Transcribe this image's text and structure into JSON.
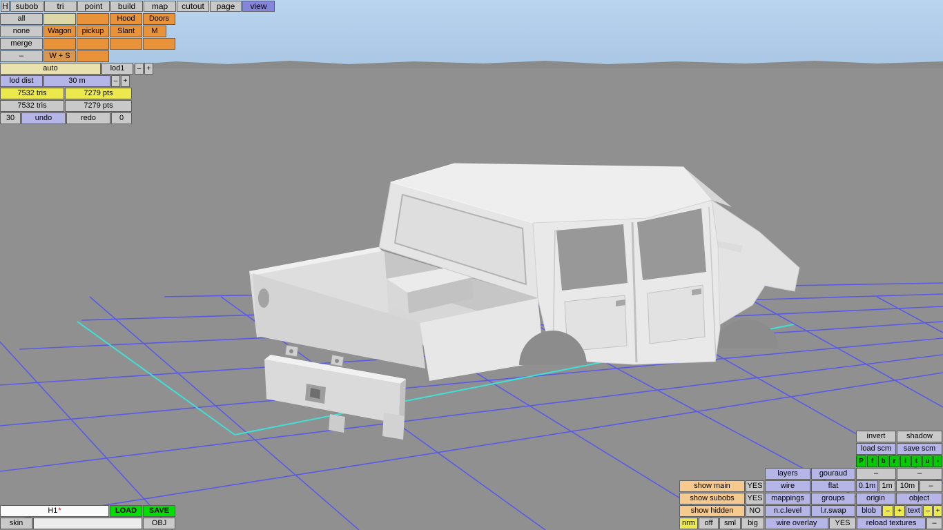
{
  "menubar": {
    "items": [
      "H",
      "subob",
      "tri",
      "point",
      "build",
      "map",
      "cutout",
      "page",
      "view"
    ],
    "active_item": "view"
  },
  "subob_panel": {
    "rows": [
      [
        "all",
        "",
        "",
        "Hood",
        "Doors"
      ],
      [
        "none",
        "Wagon",
        "pickup",
        "Slant",
        "M"
      ],
      [
        "merge",
        "",
        "",
        "",
        ""
      ],
      [
        "–",
        "W + S",
        ""
      ]
    ]
  },
  "lod_panel": {
    "auto_label": "auto",
    "lod_label": "lod1",
    "lod_minus": "–",
    "lod_plus": "+",
    "dist_label": "lod dist",
    "dist_value": "30 m",
    "dist_minus": "–",
    "dist_plus": "+",
    "tris_current": "7532 tris",
    "pts_current": "7279 pts",
    "tris_total": "7532 tris",
    "pts_total": "7279 pts",
    "undo_count": "30",
    "undo_label": "undo",
    "redo_label": "redo",
    "redo_count": "0"
  },
  "file_panel": {
    "model_name": "H1",
    "modified_marker": "*",
    "load_label": "LOAD",
    "save_label": "SAVE",
    "skin_label": "skin",
    "skin_value": "",
    "obj_label": "OBJ"
  },
  "view_panel": {
    "invert": "invert",
    "shadow": "shadow",
    "load_scm": "load scm",
    "save_scm": "save scm",
    "view_buttons": [
      "P",
      "f",
      "b",
      "r",
      "l",
      "t",
      "u",
      "●"
    ],
    "dash_left": "–",
    "dash_right": "–",
    "layers": "layers",
    "gouraud": "gouraud",
    "show_main": "show main",
    "show_main_value": "YES",
    "wire": "wire",
    "flat": "flat",
    "grid_01m": "0.1m",
    "grid_1m": "1m",
    "grid_10m": "10m",
    "grid_dash": "–",
    "show_subobs": "show subobs",
    "show_subobs_value": "YES",
    "mappings": "mappings",
    "groups": "groups",
    "origin": "origin",
    "object": "object",
    "show_hidden": "show hidden",
    "show_hidden_value": "NO",
    "nc_level": "n.c.level",
    "lr_swap": "l.r.swap",
    "blob": "blob",
    "blob_minus": "–",
    "blob_plus": "+",
    "text": "text",
    "text_minus": "–",
    "text_plus": "+",
    "nrm": "nrm",
    "nrm_off": "off",
    "nrm_sml": "sml",
    "nrm_big": "big",
    "wire_overlay": "wire overlay",
    "wire_overlay_value": "YES",
    "reload_textures": "reload textures",
    "reload_dash": "–"
  },
  "colors": {
    "sky_top": "#b9d4ee",
    "sky_bottom": "#a9c6e4",
    "viewport_bg": "#909090",
    "grid_blue": "#5a5ae6",
    "grid_cyan": "#3fe0d6",
    "selection_purple": "#8585da",
    "button_gray": "#c9c9c9",
    "button_lavender": "#b5b5e8",
    "button_orange": "#e8923a",
    "button_yellow": "#ece94e",
    "button_green": "#00cc00",
    "button_peach": "#f6c98f",
    "model_body": "#e9e9e9"
  }
}
